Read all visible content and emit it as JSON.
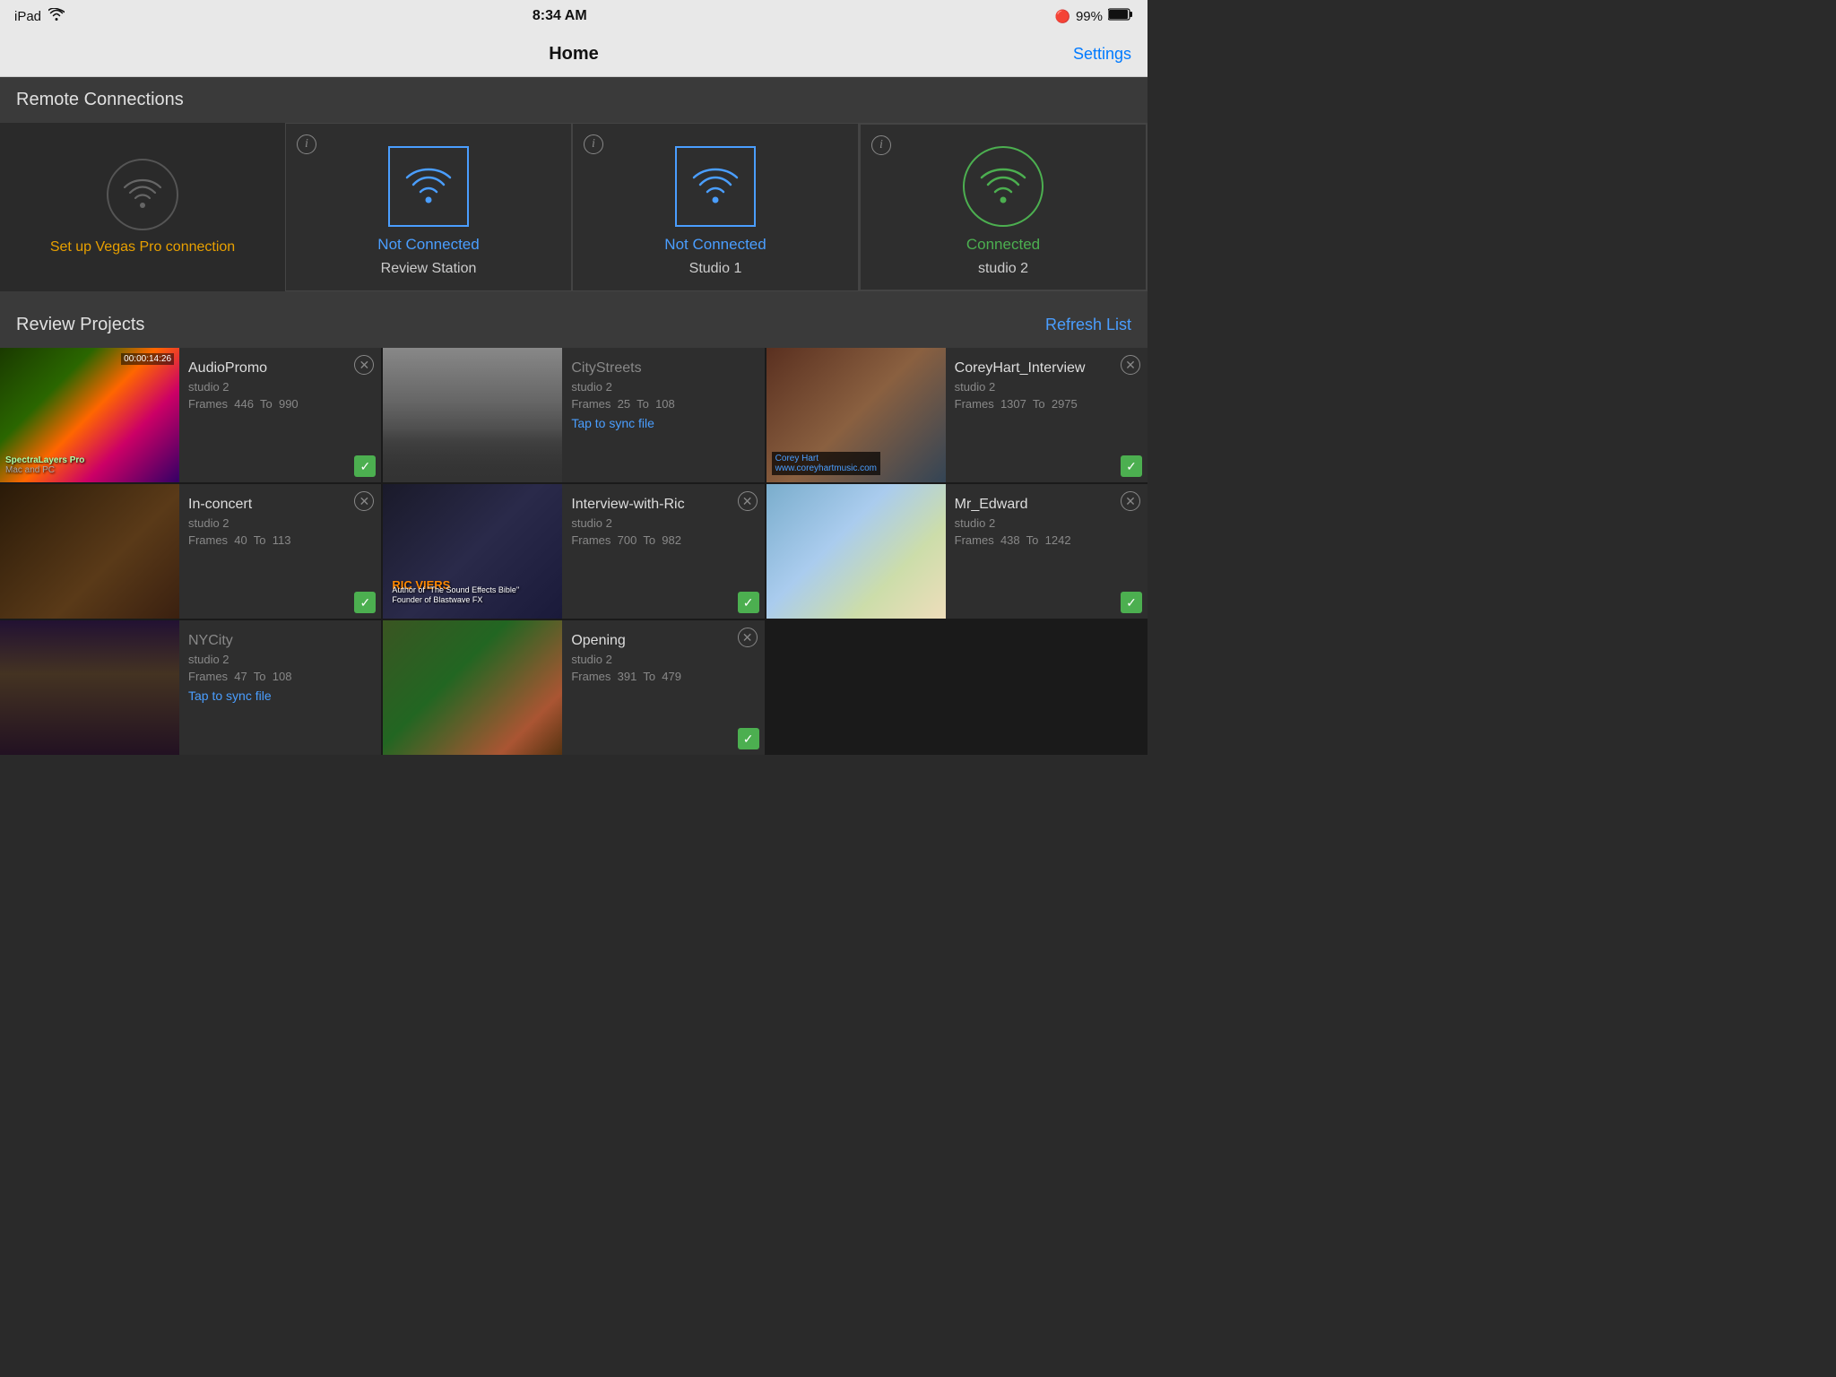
{
  "statusBar": {
    "device": "iPad",
    "wifi": "wifi-icon",
    "time": "8:34 AM",
    "bluetooth": "bluetooth-icon",
    "battery": "99%",
    "battery_icon": "battery-full-icon"
  },
  "navBar": {
    "title": "Home",
    "settings_label": "Settings"
  },
  "remoteConnections": {
    "section_title": "Remote Connections",
    "setup_link": "Set up Vegas Pro connection",
    "connections": [
      {
        "id": "slot1",
        "status": "setup",
        "label": "Set up Vegas Pro connection"
      },
      {
        "id": "review-station",
        "status": "Not Connected",
        "label": "Review Station",
        "status_type": "not_connected"
      },
      {
        "id": "studio1",
        "status": "Not Connected",
        "label": "Studio 1",
        "status_type": "not_connected"
      },
      {
        "id": "studio2",
        "status": "Connected",
        "label": "studio 2",
        "status_type": "connected"
      }
    ]
  },
  "reviewProjects": {
    "section_title": "Review Projects",
    "refresh_label": "Refresh List",
    "projects": [
      {
        "id": "audiopromo",
        "title": "AudioPromo",
        "studio": "studio 2",
        "frames_label": "Frames",
        "frames_from": "446",
        "frames_to_label": "To",
        "frames_to": "990",
        "thumb_class": "thumb-audiopromo",
        "has_check": true,
        "has_close": true,
        "timecode": "00:00:14:26",
        "thumb_label": "SpectraLayers Pro\nMac and PC"
      },
      {
        "id": "citystreets",
        "title": "CityStreets",
        "studio": "studio 2",
        "frames_label": "Frames",
        "frames_from": "25",
        "frames_to_label": "To",
        "frames_to": "108",
        "thumb_class": "thumb-citystreets",
        "has_check": false,
        "has_close": false,
        "sync_label": "Tap to sync file"
      },
      {
        "id": "coreyhart",
        "title": "CoreyHart_Interview",
        "studio": "studio 2",
        "frames_label": "Frames",
        "frames_from": "1307",
        "frames_to_label": "To",
        "frames_to": "2975",
        "thumb_class": "thumb-coreyhart",
        "has_check": true,
        "has_close": true
      },
      {
        "id": "inconcert",
        "title": "In-concert",
        "studio": "studio 2",
        "frames_label": "Frames",
        "frames_from": "40",
        "frames_to_label": "To",
        "frames_to": "113",
        "thumb_class": "thumb-inconcert",
        "has_check": true,
        "has_close": true
      },
      {
        "id": "ricviers",
        "title": "Interview-with-Ric",
        "studio": "studio 2",
        "frames_label": "Frames",
        "frames_from": "700",
        "frames_to_label": "To",
        "frames_to": "982",
        "thumb_class": "thumb-ricviers",
        "has_check": true,
        "has_close": true
      },
      {
        "id": "mredward",
        "title": "Mr_Edward",
        "studio": "studio 2",
        "frames_label": "Frames",
        "frames_from": "438",
        "frames_to_label": "To",
        "frames_to": "1242",
        "thumb_class": "thumb-mredward",
        "has_check": true,
        "has_close": true
      },
      {
        "id": "nycity",
        "title": "NYCity",
        "studio": "studio 2",
        "frames_label": "Frames",
        "frames_from": "47",
        "frames_to_label": "To",
        "frames_to": "108",
        "thumb_class": "thumb-nycity",
        "has_check": false,
        "has_close": false,
        "sync_label": "Tap to sync file"
      },
      {
        "id": "opening",
        "title": "Opening",
        "studio": "studio 2",
        "frames_label": "Frames",
        "frames_from": "391",
        "frames_to_label": "To",
        "frames_to": "479",
        "thumb_class": "thumb-opening",
        "has_check": true,
        "has_close": true
      }
    ]
  },
  "icons": {
    "wifi_inactive_color": "#666",
    "wifi_blue_color": "#4a9eff",
    "wifi_green_color": "#4caf50",
    "close_color": "#888",
    "check_color": "#4caf50"
  }
}
